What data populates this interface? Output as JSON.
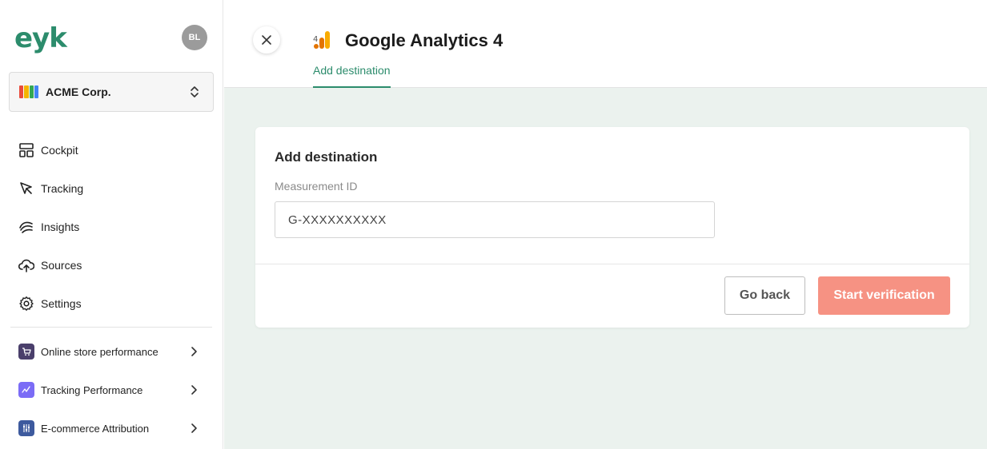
{
  "app": {
    "logo_text": "eyk",
    "user_initials": "BL"
  },
  "organization": {
    "name": "ACME Corp.",
    "logo_colors": [
      "#e94b3c",
      "#f4b400",
      "#34a853",
      "#4285f4"
    ]
  },
  "sidebar": {
    "nav_items": [
      {
        "label": "Cockpit",
        "icon": "layout-icon"
      },
      {
        "label": "Tracking",
        "icon": "cursor-icon"
      },
      {
        "label": "Insights",
        "icon": "insights-icon"
      },
      {
        "label": "Sources",
        "icon": "cloud-upload-icon"
      },
      {
        "label": "Settings",
        "icon": "gear-icon"
      }
    ],
    "reports": [
      {
        "label": "Online store performance",
        "icon": "cart-icon",
        "color": "#4a3f6b"
      },
      {
        "label": "Tracking Performance",
        "icon": "pulse-icon",
        "color": "#7b6cf6"
      },
      {
        "label": "E-commerce Attribution",
        "icon": "sliders-icon",
        "color": "#3d5a9e"
      }
    ]
  },
  "header": {
    "title": "Google Analytics 4",
    "active_tab": "Add destination"
  },
  "form": {
    "title": "Add destination",
    "measurement_label": "Measurement ID",
    "measurement_placeholder": "G-XXXXXXXXXX",
    "back_label": "Go back",
    "verify_label": "Start verification"
  },
  "colors": {
    "brand": "#2c8c6c",
    "accent_button": "#f69283",
    "main_background": "#ebf2ee"
  }
}
